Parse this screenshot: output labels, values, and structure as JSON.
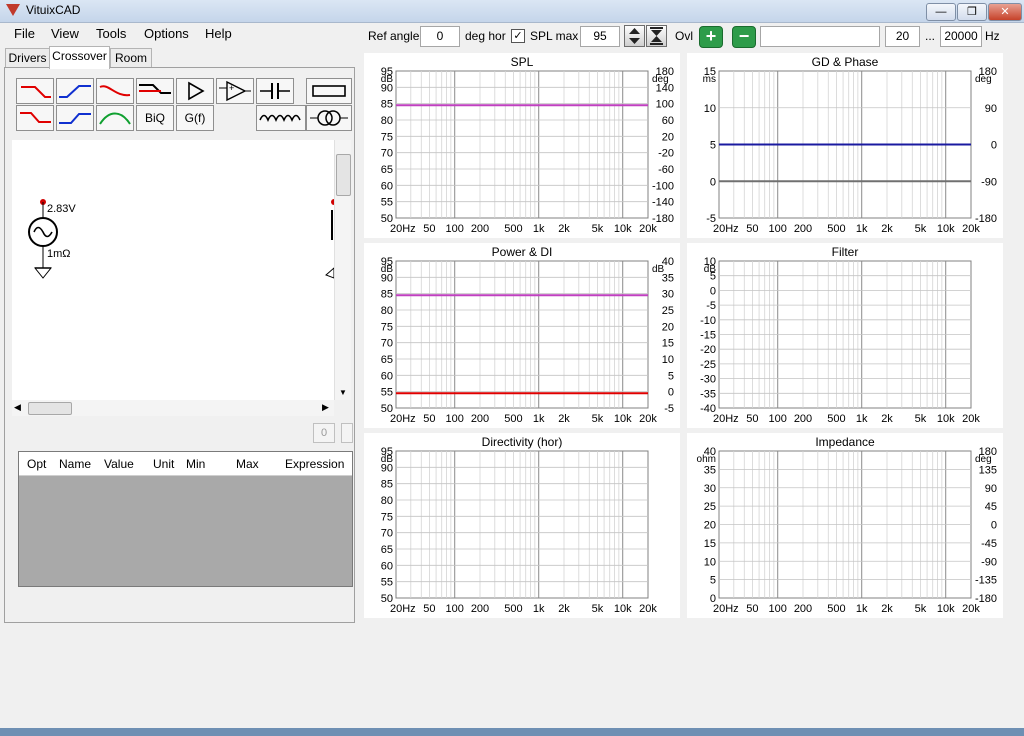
{
  "window": {
    "title": "VituixCAD",
    "min": "—",
    "max": "❐",
    "close": "✕"
  },
  "menu": [
    "File",
    "View",
    "Tools",
    "Options",
    "Help"
  ],
  "tabs": [
    "Drivers",
    "Crossover",
    "Room"
  ],
  "toolbar_buttons": {
    "biq": "BiQ",
    "gf": "G(f)"
  },
  "schematic": {
    "voltage": "2.83V",
    "impedance": "1mΩ"
  },
  "small_button": "0",
  "param_table": {
    "columns": [
      "Opt",
      "Name",
      "Value",
      "Unit",
      "Min",
      "Max",
      "Expression"
    ]
  },
  "top": {
    "ref_angle_label": "Ref angle",
    "ref_angle_value": "0",
    "deg_hor": "deg hor",
    "spl_max_label": "SPL max",
    "spl_max_value": "95",
    "spl_checked": "✓",
    "ovl_label": "Ovl",
    "plus": "+",
    "minus": "−",
    "freq_min": "20",
    "ellipsis": "...",
    "freq_max": "20000",
    "hz": "Hz"
  },
  "x_ticks": [
    "20Hz",
    "50",
    "100",
    "200",
    "500",
    "1k",
    "2k",
    "5k",
    "10k",
    "20k"
  ],
  "x_ticks_k": [
    "20Hz",
    "50",
    "100",
    "200",
    "500",
    "1k",
    "2k",
    "5k",
    "10k",
    "20k"
  ],
  "colors": {
    "magenta": "#c040c0",
    "blue": "#1a1aa0",
    "red": "#e00000",
    "gray": "#707070"
  },
  "charts": [
    {
      "title": "SPL",
      "left_unit": "dB",
      "right_unit": "deg",
      "left_ticks": [
        "95",
        "90",
        "85",
        "80",
        "75",
        "70",
        "65",
        "60",
        "55",
        "50"
      ],
      "right_ticks": [
        "180",
        "140",
        "100",
        "60",
        "20",
        "-20",
        "-60",
        "-100",
        "-140",
        "-180"
      ],
      "ylim": [
        50,
        95
      ],
      "lines": [
        {
          "y": 84.5,
          "color": "magenta"
        }
      ]
    },
    {
      "title": "GD & Phase",
      "left_unit": "ms",
      "right_unit": "deg",
      "left_ticks": [
        "15",
        "10",
        "5",
        "0",
        "-5"
      ],
      "right_ticks": [
        "180",
        "90",
        "0",
        "-90",
        "-180"
      ],
      "ylim": [
        -5,
        15
      ],
      "lines": [
        {
          "y": 5,
          "color": "blue"
        },
        {
          "y": 0,
          "color": "gray"
        }
      ]
    },
    {
      "title": "Power & DI",
      "left_unit": "dB",
      "right_unit": "dB",
      "left_ticks": [
        "95",
        "90",
        "85",
        "80",
        "75",
        "70",
        "65",
        "60",
        "55",
        "50"
      ],
      "right_ticks": [
        "40",
        "35",
        "30",
        "25",
        "20",
        "15",
        "10",
        "5",
        "0",
        "-5"
      ],
      "ylim": [
        50,
        95
      ],
      "lines": [
        {
          "y": 84.5,
          "color": "magenta"
        },
        {
          "y": 54.5,
          "color": "red"
        }
      ]
    },
    {
      "title": "Filter",
      "left_unit": "dB",
      "right_unit": "",
      "left_ticks": [
        "10",
        "5",
        "0",
        "-5",
        "-10",
        "-15",
        "-20",
        "-25",
        "-30",
        "-35",
        "-40"
      ],
      "right_ticks": [],
      "ylim": [
        -40,
        10
      ],
      "lines": []
    },
    {
      "title": "Directivity (hor)",
      "left_unit": "dB",
      "right_unit": "",
      "left_ticks": [
        "95",
        "90",
        "85",
        "80",
        "75",
        "70",
        "65",
        "60",
        "55",
        "50"
      ],
      "right_ticks": [],
      "ylim": [
        50,
        95
      ],
      "lines": []
    },
    {
      "title": "Impedance",
      "left_unit": "ohm",
      "right_unit": "deg",
      "left_ticks": [
        "40",
        "35",
        "30",
        "25",
        "20",
        "15",
        "10",
        "5",
        "0"
      ],
      "right_ticks": [
        "180",
        "135",
        "90",
        "45",
        "0",
        "-45",
        "-90",
        "-135",
        "-180"
      ],
      "ylim": [
        0,
        40
      ],
      "lines": []
    }
  ]
}
